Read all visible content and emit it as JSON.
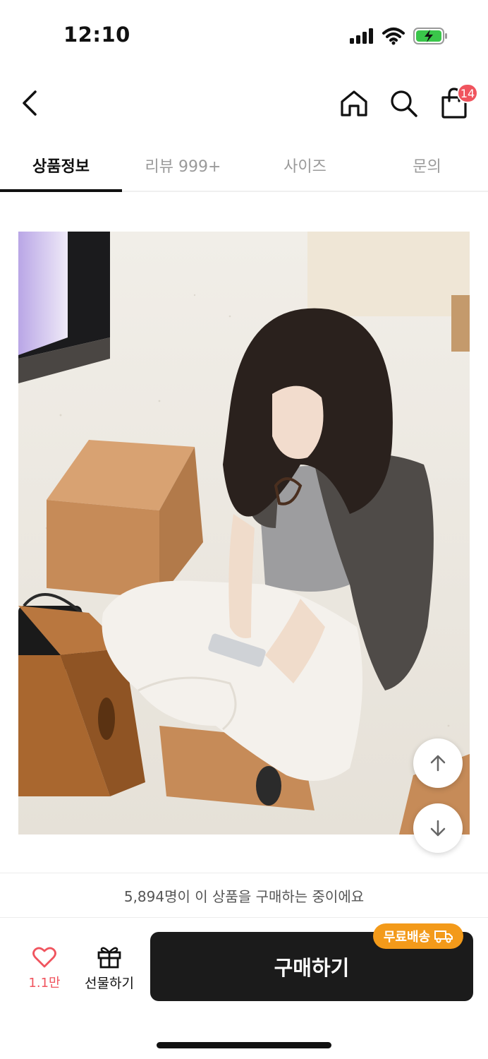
{
  "status_bar": {
    "time": "12:10"
  },
  "nav": {
    "cart_count": "14"
  },
  "tabs": [
    {
      "label": "상품정보"
    },
    {
      "label": "리뷰 999+"
    },
    {
      "label": "사이즈"
    },
    {
      "label": "문의"
    }
  ],
  "purchase_banner": "5,894명이 이 상품을 구매하는 중이에요",
  "bottom_bar": {
    "like_count": "1.1만",
    "gift_label": "선물하기",
    "buy_label": "구매하기",
    "shipping_badge": "무료배송"
  },
  "colors": {
    "accent_red": "#f0545e",
    "shipping_orange": "#f39a1a",
    "buy_button": "#1b1b1b"
  },
  "icons": [
    "back-icon",
    "home-icon",
    "search-icon",
    "shopping-bag-icon",
    "heart-icon",
    "gift-icon",
    "truck-icon",
    "arrow-up-icon",
    "arrow-down-icon"
  ]
}
